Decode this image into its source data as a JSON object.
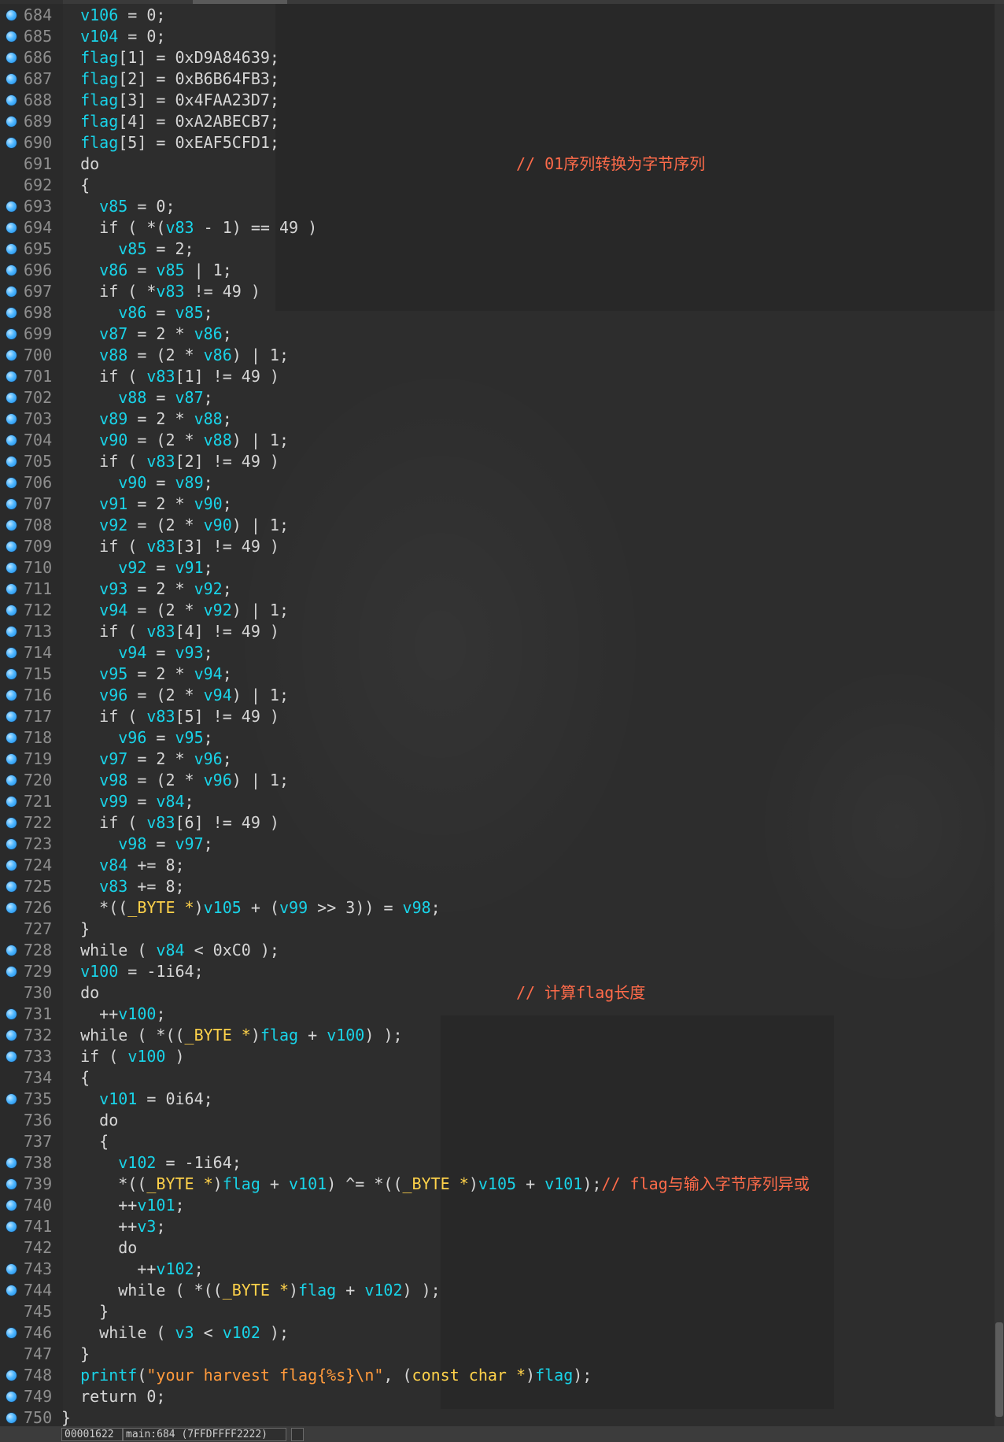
{
  "lines": [
    {
      "num": "684",
      "bp": true,
      "indent": 2,
      "tokens": [
        [
          "v",
          "v106"
        ],
        [
          "p",
          " = 0;"
        ]
      ]
    },
    {
      "num": "685",
      "bp": true,
      "indent": 2,
      "tokens": [
        [
          "v",
          "v104"
        ],
        [
          "p",
          " = 0;"
        ]
      ]
    },
    {
      "num": "686",
      "bp": true,
      "indent": 2,
      "tokens": [
        [
          "v",
          "flag"
        ],
        [
          "p",
          "[1] = 0xD9A84639;"
        ]
      ]
    },
    {
      "num": "687",
      "bp": true,
      "indent": 2,
      "tokens": [
        [
          "v",
          "flag"
        ],
        [
          "p",
          "[2] = 0xB6B64FB3;"
        ]
      ]
    },
    {
      "num": "688",
      "bp": true,
      "indent": 2,
      "tokens": [
        [
          "v",
          "flag"
        ],
        [
          "p",
          "[3] = 0x4FAA23D7;"
        ]
      ]
    },
    {
      "num": "689",
      "bp": true,
      "indent": 2,
      "tokens": [
        [
          "v",
          "flag"
        ],
        [
          "p",
          "[4] = 0xA2ABECB7;"
        ]
      ]
    },
    {
      "num": "690",
      "bp": true,
      "indent": 2,
      "tokens": [
        [
          "v",
          "flag"
        ],
        [
          "p",
          "[5] = 0xEAF5CFD1;"
        ]
      ]
    },
    {
      "num": "691",
      "bp": false,
      "indent": 2,
      "tokens": [
        [
          "p",
          "do"
        ],
        [
          "p",
          "                                            "
        ],
        [
          "c",
          "// 01序列转换为字节序列"
        ]
      ]
    },
    {
      "num": "692",
      "bp": false,
      "indent": 2,
      "tokens": [
        [
          "p",
          "{"
        ]
      ]
    },
    {
      "num": "693",
      "bp": true,
      "indent": 4,
      "tokens": [
        [
          "v",
          "v85"
        ],
        [
          "p",
          " = 0;"
        ]
      ]
    },
    {
      "num": "694",
      "bp": true,
      "indent": 4,
      "tokens": [
        [
          "p",
          "if ( *("
        ],
        [
          "v",
          "v83"
        ],
        [
          "p",
          " - 1) == 49 )"
        ]
      ]
    },
    {
      "num": "695",
      "bp": true,
      "indent": 6,
      "tokens": [
        [
          "v",
          "v85"
        ],
        [
          "p",
          " = 2;"
        ]
      ]
    },
    {
      "num": "696",
      "bp": true,
      "indent": 4,
      "tokens": [
        [
          "v",
          "v86"
        ],
        [
          "p",
          " = "
        ],
        [
          "v",
          "v85"
        ],
        [
          "p",
          " | 1;"
        ]
      ]
    },
    {
      "num": "697",
      "bp": true,
      "indent": 4,
      "tokens": [
        [
          "p",
          "if ( *"
        ],
        [
          "v",
          "v83"
        ],
        [
          "p",
          " != 49 )"
        ]
      ]
    },
    {
      "num": "698",
      "bp": true,
      "indent": 6,
      "tokens": [
        [
          "v",
          "v86"
        ],
        [
          "p",
          " = "
        ],
        [
          "v",
          "v85"
        ],
        [
          "p",
          ";"
        ]
      ]
    },
    {
      "num": "699",
      "bp": true,
      "indent": 4,
      "tokens": [
        [
          "v",
          "v87"
        ],
        [
          "p",
          " = 2 * "
        ],
        [
          "v",
          "v86"
        ],
        [
          "p",
          ";"
        ]
      ]
    },
    {
      "num": "700",
      "bp": true,
      "indent": 4,
      "tokens": [
        [
          "v",
          "v88"
        ],
        [
          "p",
          " = (2 * "
        ],
        [
          "v",
          "v86"
        ],
        [
          "p",
          ") | 1;"
        ]
      ]
    },
    {
      "num": "701",
      "bp": true,
      "indent": 4,
      "tokens": [
        [
          "p",
          "if ( "
        ],
        [
          "v",
          "v83"
        ],
        [
          "p",
          "[1] != 49 )"
        ]
      ]
    },
    {
      "num": "702",
      "bp": true,
      "indent": 6,
      "tokens": [
        [
          "v",
          "v88"
        ],
        [
          "p",
          " = "
        ],
        [
          "v",
          "v87"
        ],
        [
          "p",
          ";"
        ]
      ]
    },
    {
      "num": "703",
      "bp": true,
      "indent": 4,
      "tokens": [
        [
          "v",
          "v89"
        ],
        [
          "p",
          " = 2 * "
        ],
        [
          "v",
          "v88"
        ],
        [
          "p",
          ";"
        ]
      ]
    },
    {
      "num": "704",
      "bp": true,
      "indent": 4,
      "tokens": [
        [
          "v",
          "v90"
        ],
        [
          "p",
          " = (2 * "
        ],
        [
          "v",
          "v88"
        ],
        [
          "p",
          ") | 1;"
        ]
      ]
    },
    {
      "num": "705",
      "bp": true,
      "indent": 4,
      "tokens": [
        [
          "p",
          "if ( "
        ],
        [
          "v",
          "v83"
        ],
        [
          "p",
          "[2] != 49 )"
        ]
      ]
    },
    {
      "num": "706",
      "bp": true,
      "indent": 6,
      "tokens": [
        [
          "v",
          "v90"
        ],
        [
          "p",
          " = "
        ],
        [
          "v",
          "v89"
        ],
        [
          "p",
          ";"
        ]
      ]
    },
    {
      "num": "707",
      "bp": true,
      "indent": 4,
      "tokens": [
        [
          "v",
          "v91"
        ],
        [
          "p",
          " = 2 * "
        ],
        [
          "v",
          "v90"
        ],
        [
          "p",
          ";"
        ]
      ]
    },
    {
      "num": "708",
      "bp": true,
      "indent": 4,
      "tokens": [
        [
          "v",
          "v92"
        ],
        [
          "p",
          " = (2 * "
        ],
        [
          "v",
          "v90"
        ],
        [
          "p",
          ") | 1;"
        ]
      ]
    },
    {
      "num": "709",
      "bp": true,
      "indent": 4,
      "tokens": [
        [
          "p",
          "if ( "
        ],
        [
          "v",
          "v83"
        ],
        [
          "p",
          "[3] != 49 )"
        ]
      ]
    },
    {
      "num": "710",
      "bp": true,
      "indent": 6,
      "tokens": [
        [
          "v",
          "v92"
        ],
        [
          "p",
          " = "
        ],
        [
          "v",
          "v91"
        ],
        [
          "p",
          ";"
        ]
      ]
    },
    {
      "num": "711",
      "bp": true,
      "indent": 4,
      "tokens": [
        [
          "v",
          "v93"
        ],
        [
          "p",
          " = 2 * "
        ],
        [
          "v",
          "v92"
        ],
        [
          "p",
          ";"
        ]
      ]
    },
    {
      "num": "712",
      "bp": true,
      "indent": 4,
      "tokens": [
        [
          "v",
          "v94"
        ],
        [
          "p",
          " = (2 * "
        ],
        [
          "v",
          "v92"
        ],
        [
          "p",
          ") | 1;"
        ]
      ]
    },
    {
      "num": "713",
      "bp": true,
      "indent": 4,
      "tokens": [
        [
          "p",
          "if ( "
        ],
        [
          "v",
          "v83"
        ],
        [
          "p",
          "[4] != 49 )"
        ]
      ]
    },
    {
      "num": "714",
      "bp": true,
      "indent": 6,
      "tokens": [
        [
          "v",
          "v94"
        ],
        [
          "p",
          " = "
        ],
        [
          "v",
          "v93"
        ],
        [
          "p",
          ";"
        ]
      ]
    },
    {
      "num": "715",
      "bp": true,
      "indent": 4,
      "tokens": [
        [
          "v",
          "v95"
        ],
        [
          "p",
          " = 2 * "
        ],
        [
          "v",
          "v94"
        ],
        [
          "p",
          ";"
        ]
      ]
    },
    {
      "num": "716",
      "bp": true,
      "indent": 4,
      "tokens": [
        [
          "v",
          "v96"
        ],
        [
          "p",
          " = (2 * "
        ],
        [
          "v",
          "v94"
        ],
        [
          "p",
          ") | 1;"
        ]
      ]
    },
    {
      "num": "717",
      "bp": true,
      "indent": 4,
      "tokens": [
        [
          "p",
          "if ( "
        ],
        [
          "v",
          "v83"
        ],
        [
          "p",
          "[5] != 49 )"
        ]
      ]
    },
    {
      "num": "718",
      "bp": true,
      "indent": 6,
      "tokens": [
        [
          "v",
          "v96"
        ],
        [
          "p",
          " = "
        ],
        [
          "v",
          "v95"
        ],
        [
          "p",
          ";"
        ]
      ]
    },
    {
      "num": "719",
      "bp": true,
      "indent": 4,
      "tokens": [
        [
          "v",
          "v97"
        ],
        [
          "p",
          " = 2 * "
        ],
        [
          "v",
          "v96"
        ],
        [
          "p",
          ";"
        ]
      ]
    },
    {
      "num": "720",
      "bp": true,
      "indent": 4,
      "tokens": [
        [
          "v",
          "v98"
        ],
        [
          "p",
          " = (2 * "
        ],
        [
          "v",
          "v96"
        ],
        [
          "p",
          ") | 1;"
        ]
      ]
    },
    {
      "num": "721",
      "bp": true,
      "indent": 4,
      "tokens": [
        [
          "v",
          "v99"
        ],
        [
          "p",
          " = "
        ],
        [
          "v",
          "v84"
        ],
        [
          "p",
          ";"
        ]
      ]
    },
    {
      "num": "722",
      "bp": true,
      "indent": 4,
      "tokens": [
        [
          "p",
          "if ( "
        ],
        [
          "v",
          "v83"
        ],
        [
          "p",
          "[6] != 49 )"
        ]
      ]
    },
    {
      "num": "723",
      "bp": true,
      "indent": 6,
      "tokens": [
        [
          "v",
          "v98"
        ],
        [
          "p",
          " = "
        ],
        [
          "v",
          "v97"
        ],
        [
          "p",
          ";"
        ]
      ]
    },
    {
      "num": "724",
      "bp": true,
      "indent": 4,
      "tokens": [
        [
          "v",
          "v84"
        ],
        [
          "p",
          " += 8;"
        ]
      ]
    },
    {
      "num": "725",
      "bp": true,
      "indent": 4,
      "tokens": [
        [
          "v",
          "v83"
        ],
        [
          "p",
          " += 8;"
        ]
      ]
    },
    {
      "num": "726",
      "bp": true,
      "indent": 4,
      "tokens": [
        [
          "p",
          "*(("
        ],
        [
          "t",
          "_BYTE *"
        ],
        [
          "p",
          ")"
        ],
        [
          "v",
          "v105"
        ],
        [
          "p",
          " + ("
        ],
        [
          "v",
          "v99"
        ],
        [
          "p",
          " >> 3)) = "
        ],
        [
          "v",
          "v98"
        ],
        [
          "p",
          ";"
        ]
      ]
    },
    {
      "num": "727",
      "bp": false,
      "indent": 2,
      "tokens": [
        [
          "p",
          "}"
        ]
      ]
    },
    {
      "num": "728",
      "bp": true,
      "indent": 2,
      "tokens": [
        [
          "p",
          "while ( "
        ],
        [
          "v",
          "v84"
        ],
        [
          "p",
          " < 0xC0 );"
        ]
      ]
    },
    {
      "num": "729",
      "bp": true,
      "indent": 2,
      "tokens": [
        [
          "v",
          "v100"
        ],
        [
          "p",
          " = -1i64;"
        ]
      ]
    },
    {
      "num": "730",
      "bp": false,
      "indent": 2,
      "tokens": [
        [
          "p",
          "do"
        ],
        [
          "p",
          "                                            "
        ],
        [
          "c",
          "// 计算flag长度"
        ]
      ]
    },
    {
      "num": "731",
      "bp": true,
      "indent": 4,
      "tokens": [
        [
          "p",
          "++"
        ],
        [
          "v",
          "v100"
        ],
        [
          "p",
          ";"
        ]
      ]
    },
    {
      "num": "732",
      "bp": true,
      "indent": 2,
      "tokens": [
        [
          "p",
          "while ( *(("
        ],
        [
          "t",
          "_BYTE *"
        ],
        [
          "p",
          ")"
        ],
        [
          "v",
          "flag"
        ],
        [
          "p",
          " + "
        ],
        [
          "v",
          "v100"
        ],
        [
          "p",
          ") );"
        ]
      ]
    },
    {
      "num": "733",
      "bp": true,
      "indent": 2,
      "tokens": [
        [
          "p",
          "if ( "
        ],
        [
          "v",
          "v100"
        ],
        [
          "p",
          " )"
        ]
      ]
    },
    {
      "num": "734",
      "bp": false,
      "indent": 2,
      "tokens": [
        [
          "p",
          "{"
        ]
      ]
    },
    {
      "num": "735",
      "bp": true,
      "indent": 4,
      "tokens": [
        [
          "v",
          "v101"
        ],
        [
          "p",
          " = 0i64;"
        ]
      ]
    },
    {
      "num": "736",
      "bp": false,
      "indent": 4,
      "tokens": [
        [
          "p",
          "do"
        ]
      ]
    },
    {
      "num": "737",
      "bp": false,
      "indent": 4,
      "tokens": [
        [
          "p",
          "{"
        ]
      ]
    },
    {
      "num": "738",
      "bp": true,
      "indent": 6,
      "tokens": [
        [
          "v",
          "v102"
        ],
        [
          "p",
          " = -1i64;"
        ]
      ]
    },
    {
      "num": "739",
      "bp": true,
      "indent": 6,
      "tokens": [
        [
          "p",
          "*(("
        ],
        [
          "t",
          "_BYTE *"
        ],
        [
          "p",
          ")"
        ],
        [
          "v",
          "flag"
        ],
        [
          "p",
          " + "
        ],
        [
          "v",
          "v101"
        ],
        [
          "p",
          ") ^= *(("
        ],
        [
          "t",
          "_BYTE *"
        ],
        [
          "p",
          ")"
        ],
        [
          "v",
          "v105"
        ],
        [
          "p",
          " + "
        ],
        [
          "v",
          "v101"
        ],
        [
          "p",
          ");"
        ],
        [
          "c",
          "// flag与输入字节序列异或"
        ]
      ]
    },
    {
      "num": "740",
      "bp": true,
      "indent": 6,
      "tokens": [
        [
          "p",
          "++"
        ],
        [
          "v",
          "v101"
        ],
        [
          "p",
          ";"
        ]
      ]
    },
    {
      "num": "741",
      "bp": true,
      "indent": 6,
      "tokens": [
        [
          "p",
          "++"
        ],
        [
          "v",
          "v3"
        ],
        [
          "p",
          ";"
        ]
      ]
    },
    {
      "num": "742",
      "bp": false,
      "indent": 6,
      "tokens": [
        [
          "p",
          "do"
        ]
      ]
    },
    {
      "num": "743",
      "bp": true,
      "indent": 8,
      "tokens": [
        [
          "p",
          "++"
        ],
        [
          "v",
          "v102"
        ],
        [
          "p",
          ";"
        ]
      ]
    },
    {
      "num": "744",
      "bp": true,
      "indent": 6,
      "tokens": [
        [
          "p",
          "while ( *(("
        ],
        [
          "t",
          "_BYTE *"
        ],
        [
          "p",
          ")"
        ],
        [
          "v",
          "flag"
        ],
        [
          "p",
          " + "
        ],
        [
          "v",
          "v102"
        ],
        [
          "p",
          ") );"
        ]
      ]
    },
    {
      "num": "745",
      "bp": false,
      "indent": 4,
      "tokens": [
        [
          "p",
          "}"
        ]
      ]
    },
    {
      "num": "746",
      "bp": true,
      "indent": 4,
      "tokens": [
        [
          "p",
          "while ( "
        ],
        [
          "v",
          "v3"
        ],
        [
          "p",
          " < "
        ],
        [
          "v",
          "v102"
        ],
        [
          "p",
          " );"
        ]
      ]
    },
    {
      "num": "747",
      "bp": false,
      "indent": 2,
      "tokens": [
        [
          "p",
          "}"
        ]
      ]
    },
    {
      "num": "748",
      "bp": true,
      "indent": 2,
      "tokens": [
        [
          "v",
          "printf"
        ],
        [
          "p",
          "("
        ],
        [
          "s",
          "\"your harvest flag{%s}\\n\""
        ],
        [
          "p",
          ", ("
        ],
        [
          "t",
          "const char *"
        ],
        [
          "p",
          ")"
        ],
        [
          "v",
          "flag"
        ],
        [
          "p",
          ");"
        ]
      ]
    },
    {
      "num": "749",
      "bp": true,
      "indent": 2,
      "tokens": [
        [
          "p",
          "return 0;"
        ]
      ]
    },
    {
      "num": "750",
      "bp": true,
      "indent": 0,
      "tokens": [
        [
          "p",
          "}"
        ]
      ]
    }
  ],
  "statusbar": {
    "offset": "00001622",
    "location": "main:684 (7FFDFFFF2222)"
  },
  "colors": {
    "variable": "#19d3e8",
    "type": "#ffd24a",
    "string": "#ff9a3c",
    "comment": "#ff6b4a",
    "plain": "#d6d6d6",
    "line_number": "#8e8e8e",
    "breakpoint": "#4db6ff"
  }
}
